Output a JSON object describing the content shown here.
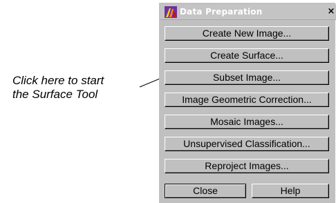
{
  "annotation": {
    "line1": "Click here to start",
    "line2": "the Surface Tool"
  },
  "window": {
    "title": "Data Preparation",
    "close_glyph": "×"
  },
  "menu": {
    "items": [
      {
        "label": "Create New Image..."
      },
      {
        "label": "Create Surface..."
      },
      {
        "label": "Subset Image..."
      },
      {
        "label": "Image Geometric Correction..."
      },
      {
        "label": "Mosaic Images..."
      },
      {
        "label": "Unsupervised Classification..."
      },
      {
        "label": "Reproject Images..."
      }
    ]
  },
  "footer": {
    "close_label": "Close",
    "help_label": "Help"
  }
}
